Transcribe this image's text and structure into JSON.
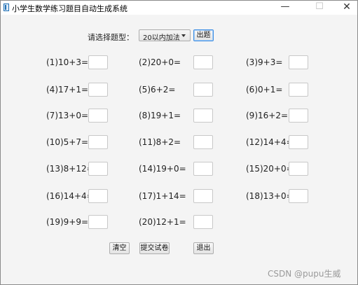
{
  "window": {
    "title": "小学生数学练习题目自动生成系统",
    "minimize_glyph": "—",
    "maximize_glyph": "☐",
    "close_glyph": "✕"
  },
  "toolbar": {
    "type_label": "请选择题型：",
    "type_selected": "20以内加法",
    "generate_label": "出题"
  },
  "questions": [
    "(1)10+3=",
    "(2)20+0=",
    "(3)9+3=",
    "(4)17+1=",
    "(5)6+2=",
    "(6)0+1=",
    "(7)13+0=",
    "(8)19+1=",
    "(9)16+2=",
    "(10)5+7=",
    "(11)8+2=",
    "(12)14+4=",
    "(13)8+12=",
    "(14)19+0=",
    "(15)20+0=",
    "(16)14+4=",
    "(17)1+14=",
    "(18)13+0=",
    "(19)9+9=",
    "(20)12+1="
  ],
  "actions": {
    "clear_label": "清空",
    "submit_label": "提交试卷",
    "exit_label": "退出"
  },
  "watermark": "CSDN @pupu生威"
}
